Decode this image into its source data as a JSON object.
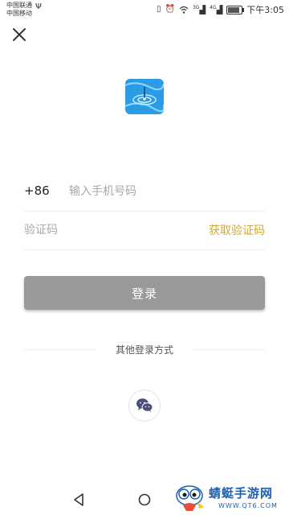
{
  "status_bar": {
    "carrier_1": "中国联通",
    "carrier_2": "中国移动",
    "usb_icon": "usb-icon",
    "network_gen_1": "3G",
    "network_gen_2": "4G",
    "time": "下午3:05",
    "battery_level": 0.85
  },
  "header": {
    "close_icon": "close-icon"
  },
  "app": {
    "logo_icon": "water-ripple-logo",
    "logo_colors": [
      "#2b9be6",
      "#56c1f5"
    ]
  },
  "form": {
    "country_code": "+86",
    "phone_placeholder": "输入手机号码",
    "code_placeholder": "验证码",
    "get_code_label": "获取验证码",
    "accent_color": "#d4a82c"
  },
  "login": {
    "label": "登录",
    "bg_color": "#999999"
  },
  "other_login": {
    "label": "其他登录方式",
    "providers": [
      {
        "icon": "wechat-icon"
      }
    ]
  },
  "nav_bar": {
    "back_icon": "back-triangle-icon",
    "home_icon": "home-circle-icon"
  },
  "watermark": {
    "title": "蜻蜓手游网",
    "url": "WWW.QT6.COM"
  }
}
